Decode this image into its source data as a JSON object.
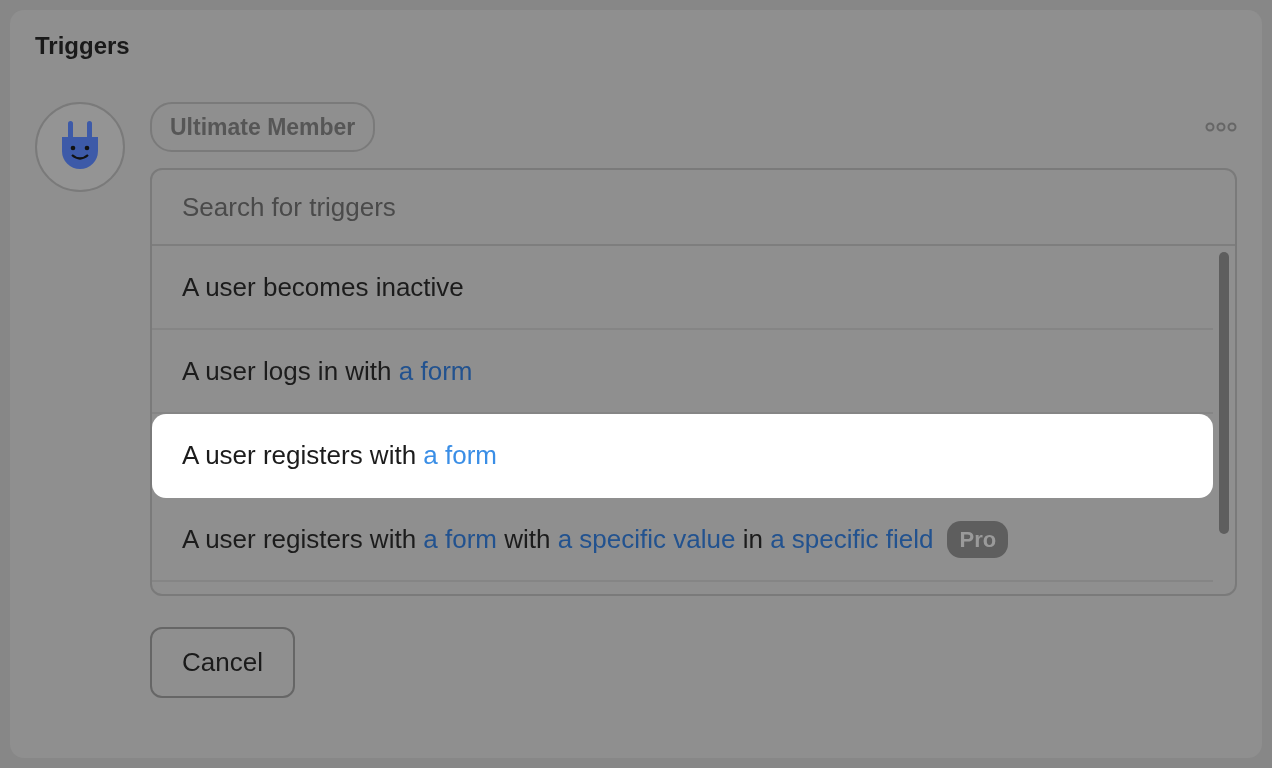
{
  "panel": {
    "title": "Triggers"
  },
  "integration": {
    "name": "Ultimate Member"
  },
  "search": {
    "placeholder": "Search for triggers"
  },
  "triggers": [
    {
      "selected": false,
      "parts": [
        {
          "text": "A user becomes inactive",
          "link": false
        }
      ]
    },
    {
      "selected": false,
      "parts": [
        {
          "text": "A user logs in with ",
          "link": false
        },
        {
          "text": "a form",
          "link": true
        }
      ]
    },
    {
      "selected": true,
      "parts": [
        {
          "text": "A user registers with ",
          "link": false
        },
        {
          "text": "a form",
          "link": true
        }
      ]
    },
    {
      "selected": false,
      "badge": "Pro",
      "parts": [
        {
          "text": "A user registers with ",
          "link": false
        },
        {
          "text": "a form",
          "link": true
        },
        {
          "text": " with ",
          "link": false
        },
        {
          "text": "a specific value",
          "link": true
        },
        {
          "text": " in ",
          "link": false
        },
        {
          "text": "a specific field",
          "link": true
        }
      ]
    }
  ],
  "buttons": [
    {
      "label": "Cancel"
    }
  ]
}
